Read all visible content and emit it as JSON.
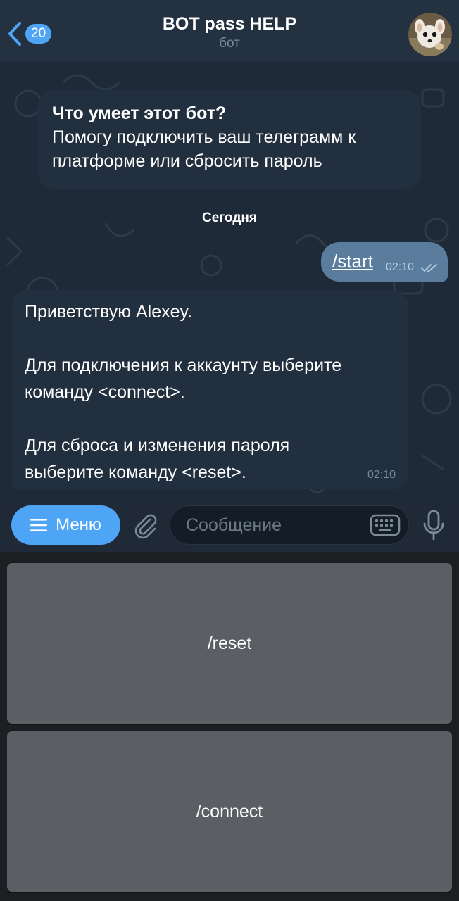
{
  "header": {
    "back_badge": "20",
    "title": "BOT pass HELP",
    "subtitle": "бот"
  },
  "chat": {
    "info": {
      "title": "Что умеет этот бот?",
      "lines": [
        "Помогу подключить ваш телеграмм к",
        "платформе или сбросить пароль"
      ]
    },
    "date_label": "Сегодня",
    "outgoing": {
      "text": "/start",
      "time": "02:10",
      "status": "read"
    },
    "incoming": {
      "lines": [
        "Приветствую Alexey.",
        "",
        "Для подключения к аккаунту выберите",
        "команду <connect>.",
        "",
        "Для сброса и изменения пароля",
        "выберите команду <reset>."
      ],
      "time": "02:10"
    }
  },
  "composer": {
    "menu_label": "Меню",
    "placeholder": "Сообщение",
    "icons": {
      "menu": "hamburger-icon",
      "attach": "paperclip-icon",
      "keyboard": "keyboard-icon",
      "mic": "microphone-icon"
    }
  },
  "keyboard_buttons": [
    "/reset",
    "/connect"
  ],
  "colors": {
    "accent": "#4ea4f5",
    "header_bg": "#233140",
    "chat_bg": "#1e2a37",
    "incoming_bubble": "#222f3e",
    "outgoing_bubble": "#5a7d9e",
    "keyboard_bg": "#1c1e21",
    "keyboard_button": "#5b5e63"
  }
}
